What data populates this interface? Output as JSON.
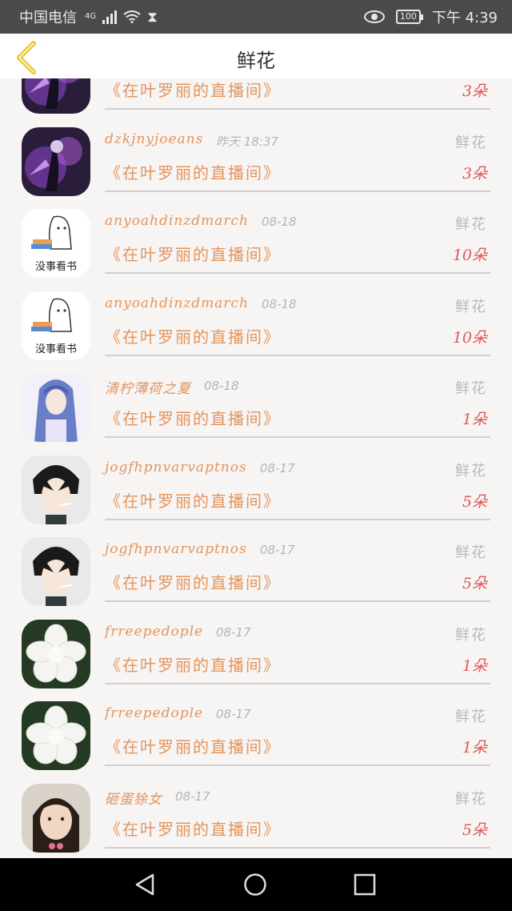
{
  "status_bar": {
    "carrier": "中国电信",
    "network": "4G",
    "battery": "100",
    "time": "下午 4:39"
  },
  "header": {
    "title": "鲜花"
  },
  "gifts": [
    {
      "avatar": "purple-warrior-avatar",
      "username": "",
      "time": "",
      "gift_type": "",
      "room": "《在叶罗丽的直播间》",
      "count": "3朵"
    },
    {
      "avatar": "purple-warrior-avatar",
      "username": "dzkjnyjoeans",
      "time": "昨天 18:37",
      "gift_type": "鲜花",
      "room": "《在叶罗丽的直播间》",
      "count": "3朵"
    },
    {
      "avatar": "book-ghost-avatar",
      "avatar_caption": "没事看书",
      "username": "anyoahdinzdmarch",
      "time": "08-18",
      "gift_type": "鲜花",
      "room": "《在叶罗丽的直播间》",
      "count": "10朵"
    },
    {
      "avatar": "book-ghost-avatar",
      "avatar_caption": "没事看书",
      "username": "anyoahdinzdmarch",
      "time": "08-18",
      "gift_type": "鲜花",
      "room": "《在叶罗丽的直播间》",
      "count": "10朵"
    },
    {
      "avatar": "anime-girl-avatar",
      "username": "清柠薄荷之夏",
      "time": "08-18",
      "gift_type": "鲜花",
      "room": "《在叶罗丽的直播间》",
      "count": "1朵"
    },
    {
      "avatar": "anime-boy-avatar",
      "username": "jogfhpnvarvaptnos",
      "time": "08-17",
      "gift_type": "鲜花",
      "room": "《在叶罗丽的直播间》",
      "count": "5朵"
    },
    {
      "avatar": "anime-boy-avatar",
      "username": "jogfhpnvarvaptnos",
      "time": "08-17",
      "gift_type": "鲜花",
      "room": "《在叶罗丽的直播间》",
      "count": "5朵"
    },
    {
      "avatar": "white-flower-avatar",
      "username": "frreepedople",
      "time": "08-17",
      "gift_type": "鲜花",
      "room": "《在叶罗丽的直播间》",
      "count": "1朵"
    },
    {
      "avatar": "white-flower-avatar",
      "username": "frreepedople",
      "time": "08-17",
      "gift_type": "鲜花",
      "room": "《在叶罗丽的直播间》",
      "count": "1朵"
    },
    {
      "avatar": "little-girl-avatar",
      "username": "砸蛋狳女",
      "time": "08-17",
      "gift_type": "鲜花",
      "room": "《在叶罗丽的直播间》",
      "count": "5朵"
    }
  ],
  "colors": {
    "accent": "#e2955c",
    "count": "#e05858",
    "back_arrow": "#e6c233"
  }
}
